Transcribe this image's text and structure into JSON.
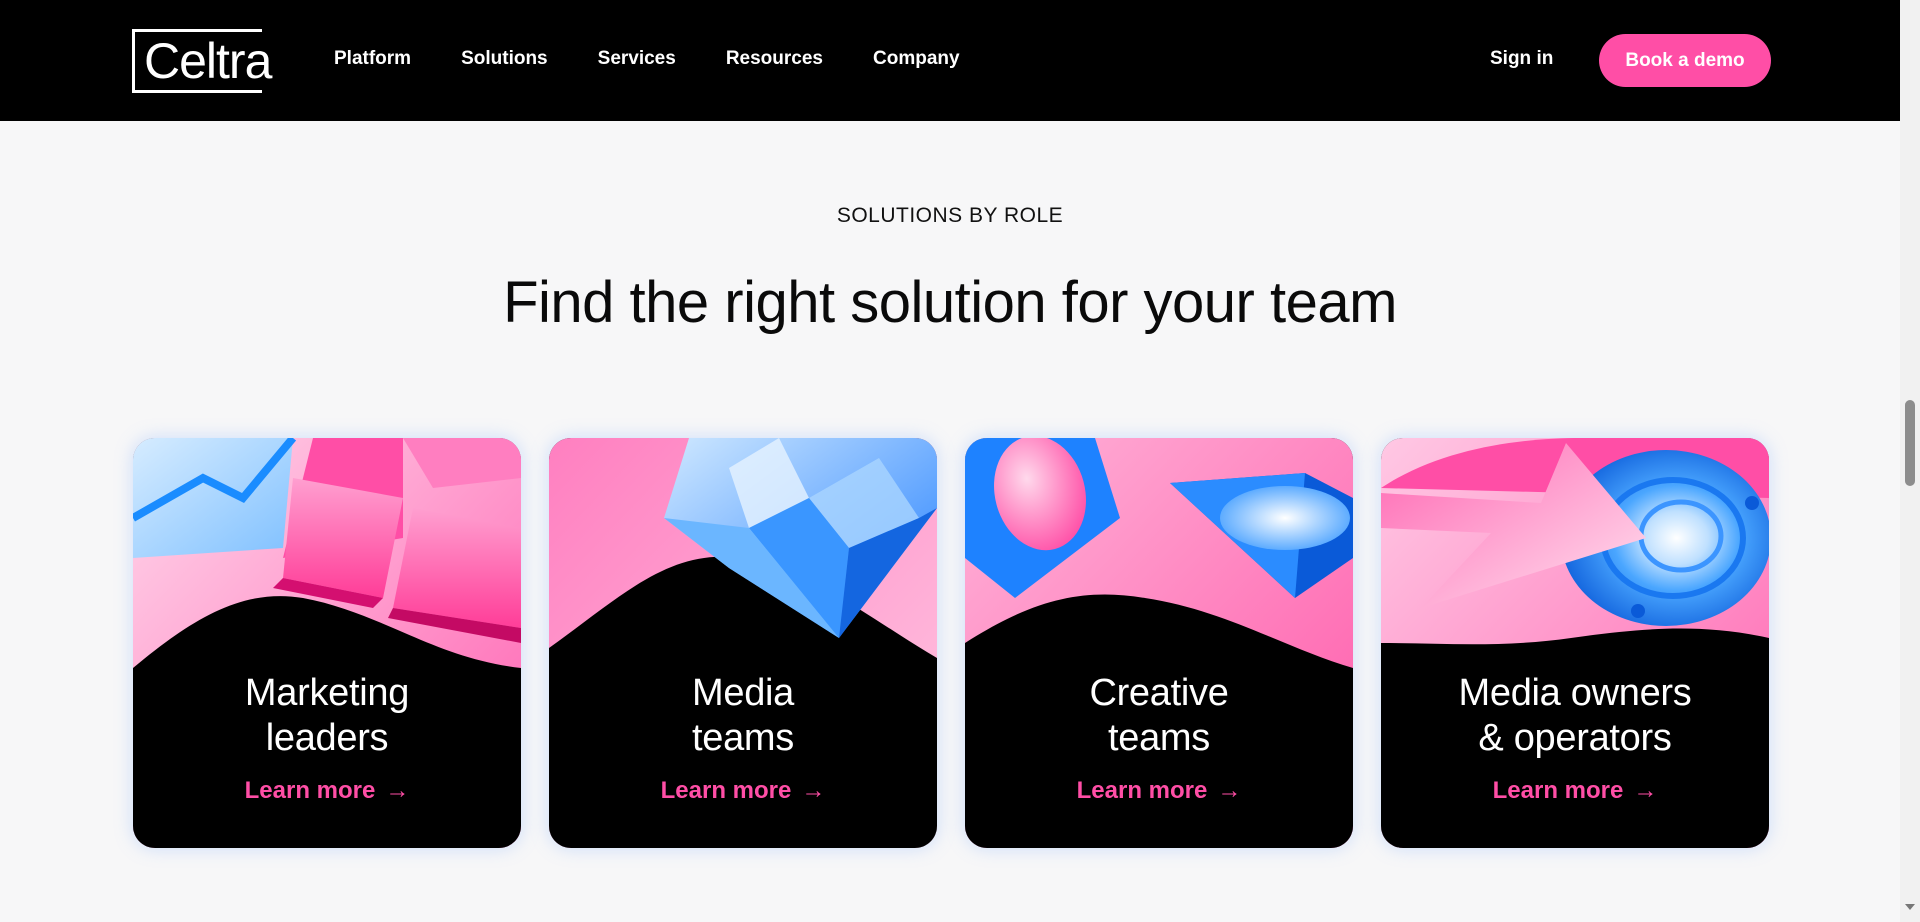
{
  "brand": {
    "logo_text": "Celtra",
    "accent": "#ff4ea6"
  },
  "nav": {
    "items": [
      "Platform",
      "Solutions",
      "Services",
      "Resources",
      "Company"
    ],
    "sign_in": "Sign in",
    "cta": "Book a demo"
  },
  "section": {
    "eyebrow": "SOLUTIONS BY ROLE",
    "headline": "Find the right solution for your team"
  },
  "cards": [
    {
      "title_line1": "Marketing",
      "title_line2": "leaders",
      "link": "Learn more",
      "arrow": "→"
    },
    {
      "title_line1": "Media",
      "title_line2": "teams",
      "link": "Learn more",
      "arrow": "→"
    },
    {
      "title_line1": "Creative",
      "title_line2": "teams",
      "link": "Learn more",
      "arrow": "→"
    },
    {
      "title_line1": "Media owners",
      "title_line2": "& operators",
      "link": "Learn more",
      "arrow": "→"
    }
  ]
}
